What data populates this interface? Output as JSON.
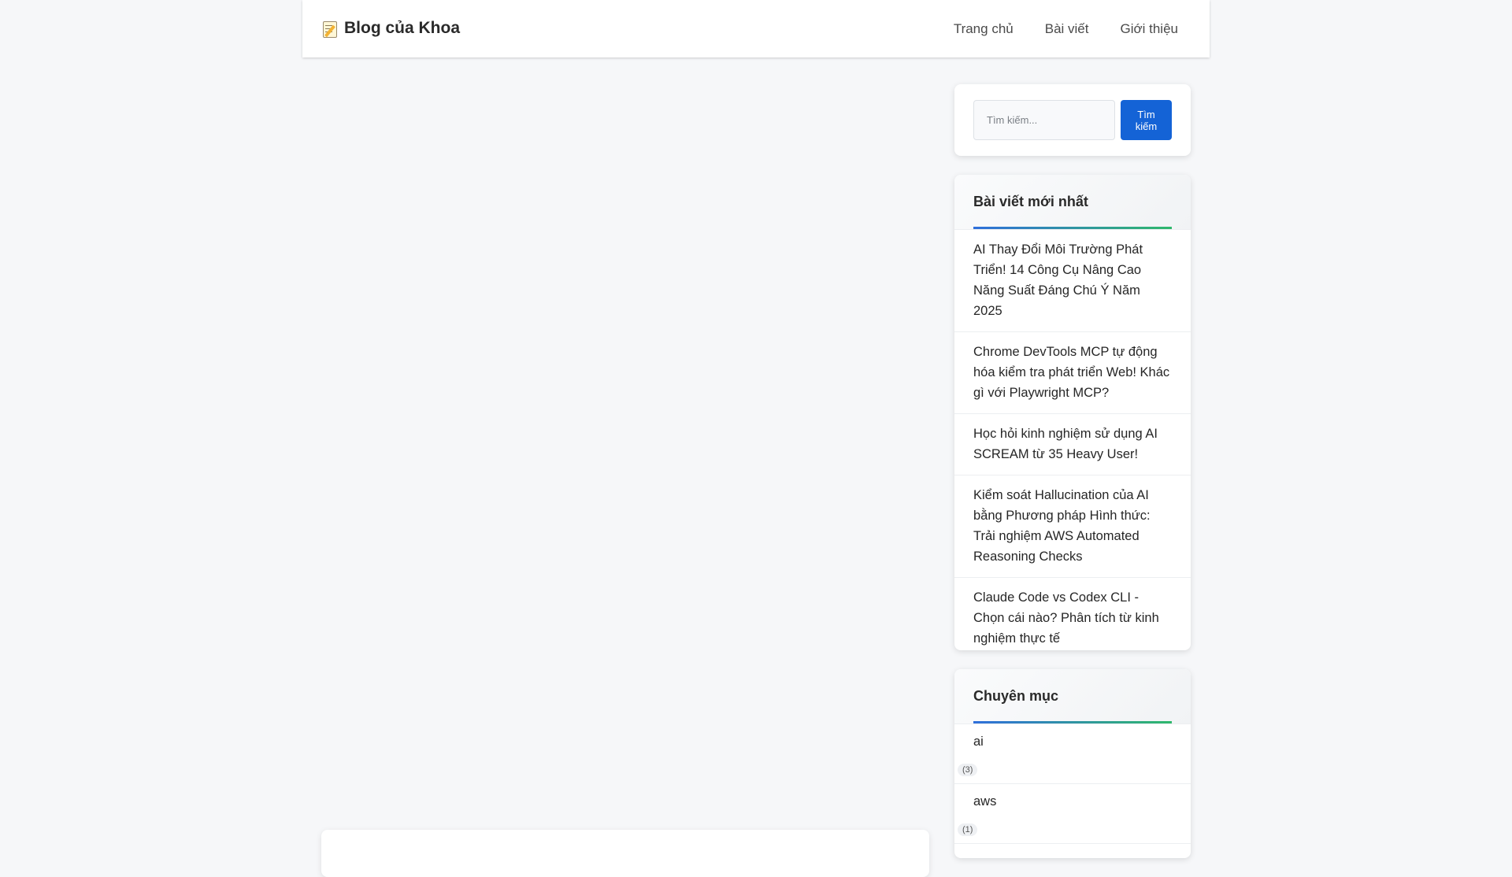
{
  "header": {
    "brand": "Blog của Khoa",
    "nav": [
      "Trang chủ",
      "Bài viết",
      "Giới thiệu"
    ]
  },
  "search": {
    "placeholder": "Tìm kiếm...",
    "button": "Tìm kiếm"
  },
  "recent_posts": {
    "title": "Bài viết mới nhất",
    "items": [
      "AI Thay Đổi Môi Trường Phát Triển! 14 Công Cụ Nâng Cao Năng Suất Đáng Chú Ý Năm 2025",
      "Chrome DevTools MCP tự động hóa kiểm tra phát triển Web! Khác gì với Playwright MCP?",
      "Học hỏi kinh nghiệm sử dụng AI SCREAM từ 35 Heavy User!",
      "Kiểm soát Hallucination của AI bằng Phương pháp Hình thức: Trải nghiệm AWS Automated Reasoning Checks",
      "Claude Code vs Codex CLI - Chọn cái nào? Phân tích từ kinh nghiệm thực tế"
    ]
  },
  "categories": {
    "title": "Chuyên mục",
    "items": [
      {
        "name": "ai",
        "count": "(3)"
      },
      {
        "name": "aws",
        "count": "(1)"
      }
    ]
  },
  "colors": {
    "accent": "#1463d6",
    "underline_start": "#2f6fdb",
    "underline_end": "#2fb86c"
  }
}
